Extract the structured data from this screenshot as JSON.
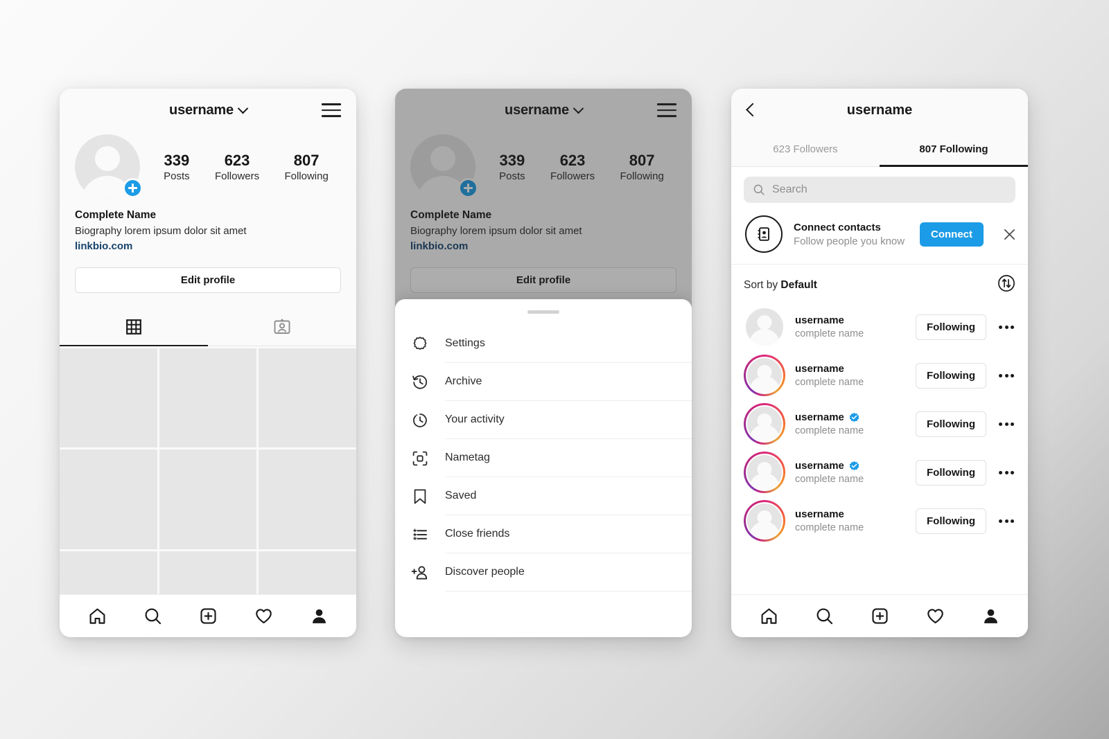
{
  "background": {
    "from": "#fbfbfb",
    "to": "#a9a9a9"
  },
  "colors": {
    "accent_blue": "#1c9be6",
    "link_blue": "#16436c",
    "text": "#161616",
    "muted": "#8e8e8e"
  },
  "profile": {
    "username": "username",
    "stats": [
      {
        "num": "339",
        "label": "Posts"
      },
      {
        "num": "623",
        "label": "Followers"
      },
      {
        "num": "807",
        "label": "Following"
      }
    ],
    "full_name": "Complete Name",
    "biography": "Biography lorem ipsum dolor sit amet",
    "link": "linkbio.com",
    "edit_button": "Edit profile",
    "tabs": [
      {
        "icon": "grid-icon",
        "active": true
      },
      {
        "icon": "tagged-person-icon",
        "active": false
      }
    ]
  },
  "bottom_nav": [
    {
      "icon": "home-icon",
      "label": "Home"
    },
    {
      "icon": "search-icon",
      "label": "Search"
    },
    {
      "icon": "add-post-icon",
      "label": "Create"
    },
    {
      "icon": "heart-icon",
      "label": "Activity"
    },
    {
      "icon": "profile-icon",
      "label": "Profile"
    }
  ],
  "menu_sheet": {
    "items": [
      {
        "icon": "gear-icon",
        "label": "Settings"
      },
      {
        "icon": "archive-icon",
        "label": "Archive"
      },
      {
        "icon": "your-activity-icon",
        "label": "Your activity"
      },
      {
        "icon": "nametag-icon",
        "label": "Nametag"
      },
      {
        "icon": "bookmark-icon",
        "label": "Saved"
      },
      {
        "icon": "close-friends-icon",
        "label": "Close friends"
      },
      {
        "icon": "discover-people-icon",
        "label": "Discover people"
      }
    ]
  },
  "following_screen": {
    "title": "username",
    "tabs": [
      {
        "label": "623 Followers",
        "active": false
      },
      {
        "label": "807 Following",
        "active": true
      }
    ],
    "search": {
      "placeholder": "Search"
    },
    "connect_contacts": {
      "title": "Connect contacts",
      "subtitle": "Follow people you know",
      "button": "Connect"
    },
    "sort": {
      "prefix": "Sort by ",
      "value": "Default"
    },
    "users": [
      {
        "username": "username",
        "full_name": "complete name",
        "verified": false,
        "story": false,
        "action": "Following"
      },
      {
        "username": "username",
        "full_name": "complete name",
        "verified": false,
        "story": true,
        "action": "Following"
      },
      {
        "username": "username",
        "full_name": "complete name",
        "verified": true,
        "story": true,
        "action": "Following"
      },
      {
        "username": "username",
        "full_name": "complete name",
        "verified": true,
        "story": true,
        "action": "Following"
      },
      {
        "username": "username",
        "full_name": "complete name",
        "verified": false,
        "story": true,
        "action": "Following"
      }
    ]
  }
}
